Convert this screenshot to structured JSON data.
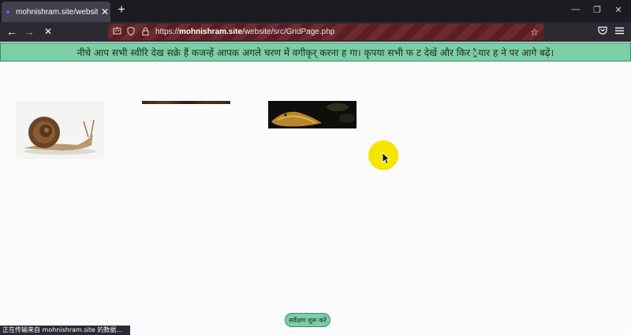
{
  "browser": {
    "tab_title": "mohnishram.site/website/src/",
    "tab_close": "✕",
    "new_tab": "+",
    "window_controls": {
      "minimize": "—",
      "restore": "❐",
      "close": "✕"
    },
    "nav": {
      "back": "←",
      "forward": "→",
      "stop": "✕"
    },
    "url_prefix": "https://",
    "url_domain": "mohnishram.site",
    "url_path": "/website/src/GridPage.php",
    "status_text": "正在传输来自 mohnishram.site 的数据..."
  },
  "page": {
    "banner_text": "नीचे आप सभी स्वीरि देख सक्रे हैं कजन्हें आपक अगले चरण में वगीकृर् करना ह गा। कृपया सभी फ ट देखें और किर ्रैयार ह ने पर आगे बढ़ें।",
    "start_button": "सर्वेक्षण शुरू करें",
    "images": [
      {
        "name": "snail"
      },
      {
        "name": "dark-strip"
      },
      {
        "name": "lizard"
      }
    ]
  },
  "colors": {
    "accent": "#7bcea5",
    "cursor_highlight": "#f5e600",
    "chrome_dark": "#1c1b22",
    "toolbar": "#2b2a33"
  }
}
